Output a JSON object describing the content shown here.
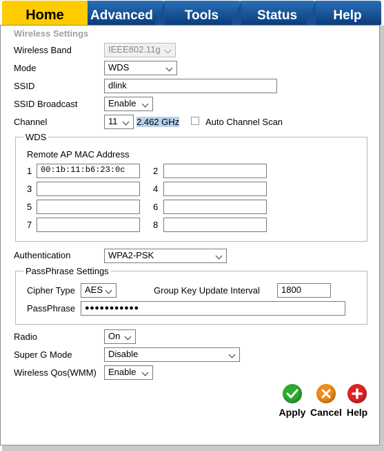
{
  "tabs": [
    {
      "label": "Home"
    },
    {
      "label": "Advanced"
    },
    {
      "label": "Tools"
    },
    {
      "label": "Status"
    },
    {
      "label": "Help"
    }
  ],
  "section_title": "Wireless Settings",
  "wireless_band": {
    "label": "Wireless Band",
    "value": "IEEE802.11g"
  },
  "mode": {
    "label": "Mode",
    "value": "WDS"
  },
  "ssid": {
    "label": "SSID",
    "value": "dlink"
  },
  "ssid_broadcast": {
    "label": "SSID Broadcast",
    "value": "Enable"
  },
  "channel": {
    "label": "Channel",
    "value": "11",
    "frequency": "2.462 GHz",
    "auto_scan_label": "Auto Channel Scan"
  },
  "wds": {
    "legend": "WDS",
    "remote_label": "Remote AP MAC Address",
    "entries": [
      {
        "num": "1",
        "value": "00:1b:11:b6:23:0c"
      },
      {
        "num": "2",
        "value": ""
      },
      {
        "num": "3",
        "value": ""
      },
      {
        "num": "4",
        "value": ""
      },
      {
        "num": "5",
        "value": ""
      },
      {
        "num": "6",
        "value": ""
      },
      {
        "num": "7",
        "value": ""
      },
      {
        "num": "8",
        "value": ""
      }
    ]
  },
  "authentication": {
    "label": "Authentication",
    "value": "WPA2-PSK"
  },
  "passphrase_settings": {
    "legend": "PassPhrase Settings",
    "cipher_label": "Cipher Type",
    "cipher_value": "AES",
    "gkui_label": "Group Key Update Interval",
    "gkui_value": "1800",
    "passphrase_label": "PassPhrase",
    "passphrase_value": "●●●●●●●●●●●"
  },
  "radio": {
    "label": "Radio",
    "value": "On"
  },
  "super_g": {
    "label": "Super G Mode",
    "value": "Disable"
  },
  "qos": {
    "label": "Wireless Qos(WMM)",
    "value": "Enable"
  },
  "actions": {
    "apply": "Apply",
    "cancel": "Cancel",
    "help": "Help"
  },
  "colors": {
    "tab_active": "#ffcc00",
    "tab_inactive": "#0b3d7a",
    "apply": "#2eaa2e",
    "cancel": "#f08a1a",
    "help": "#e02424"
  }
}
